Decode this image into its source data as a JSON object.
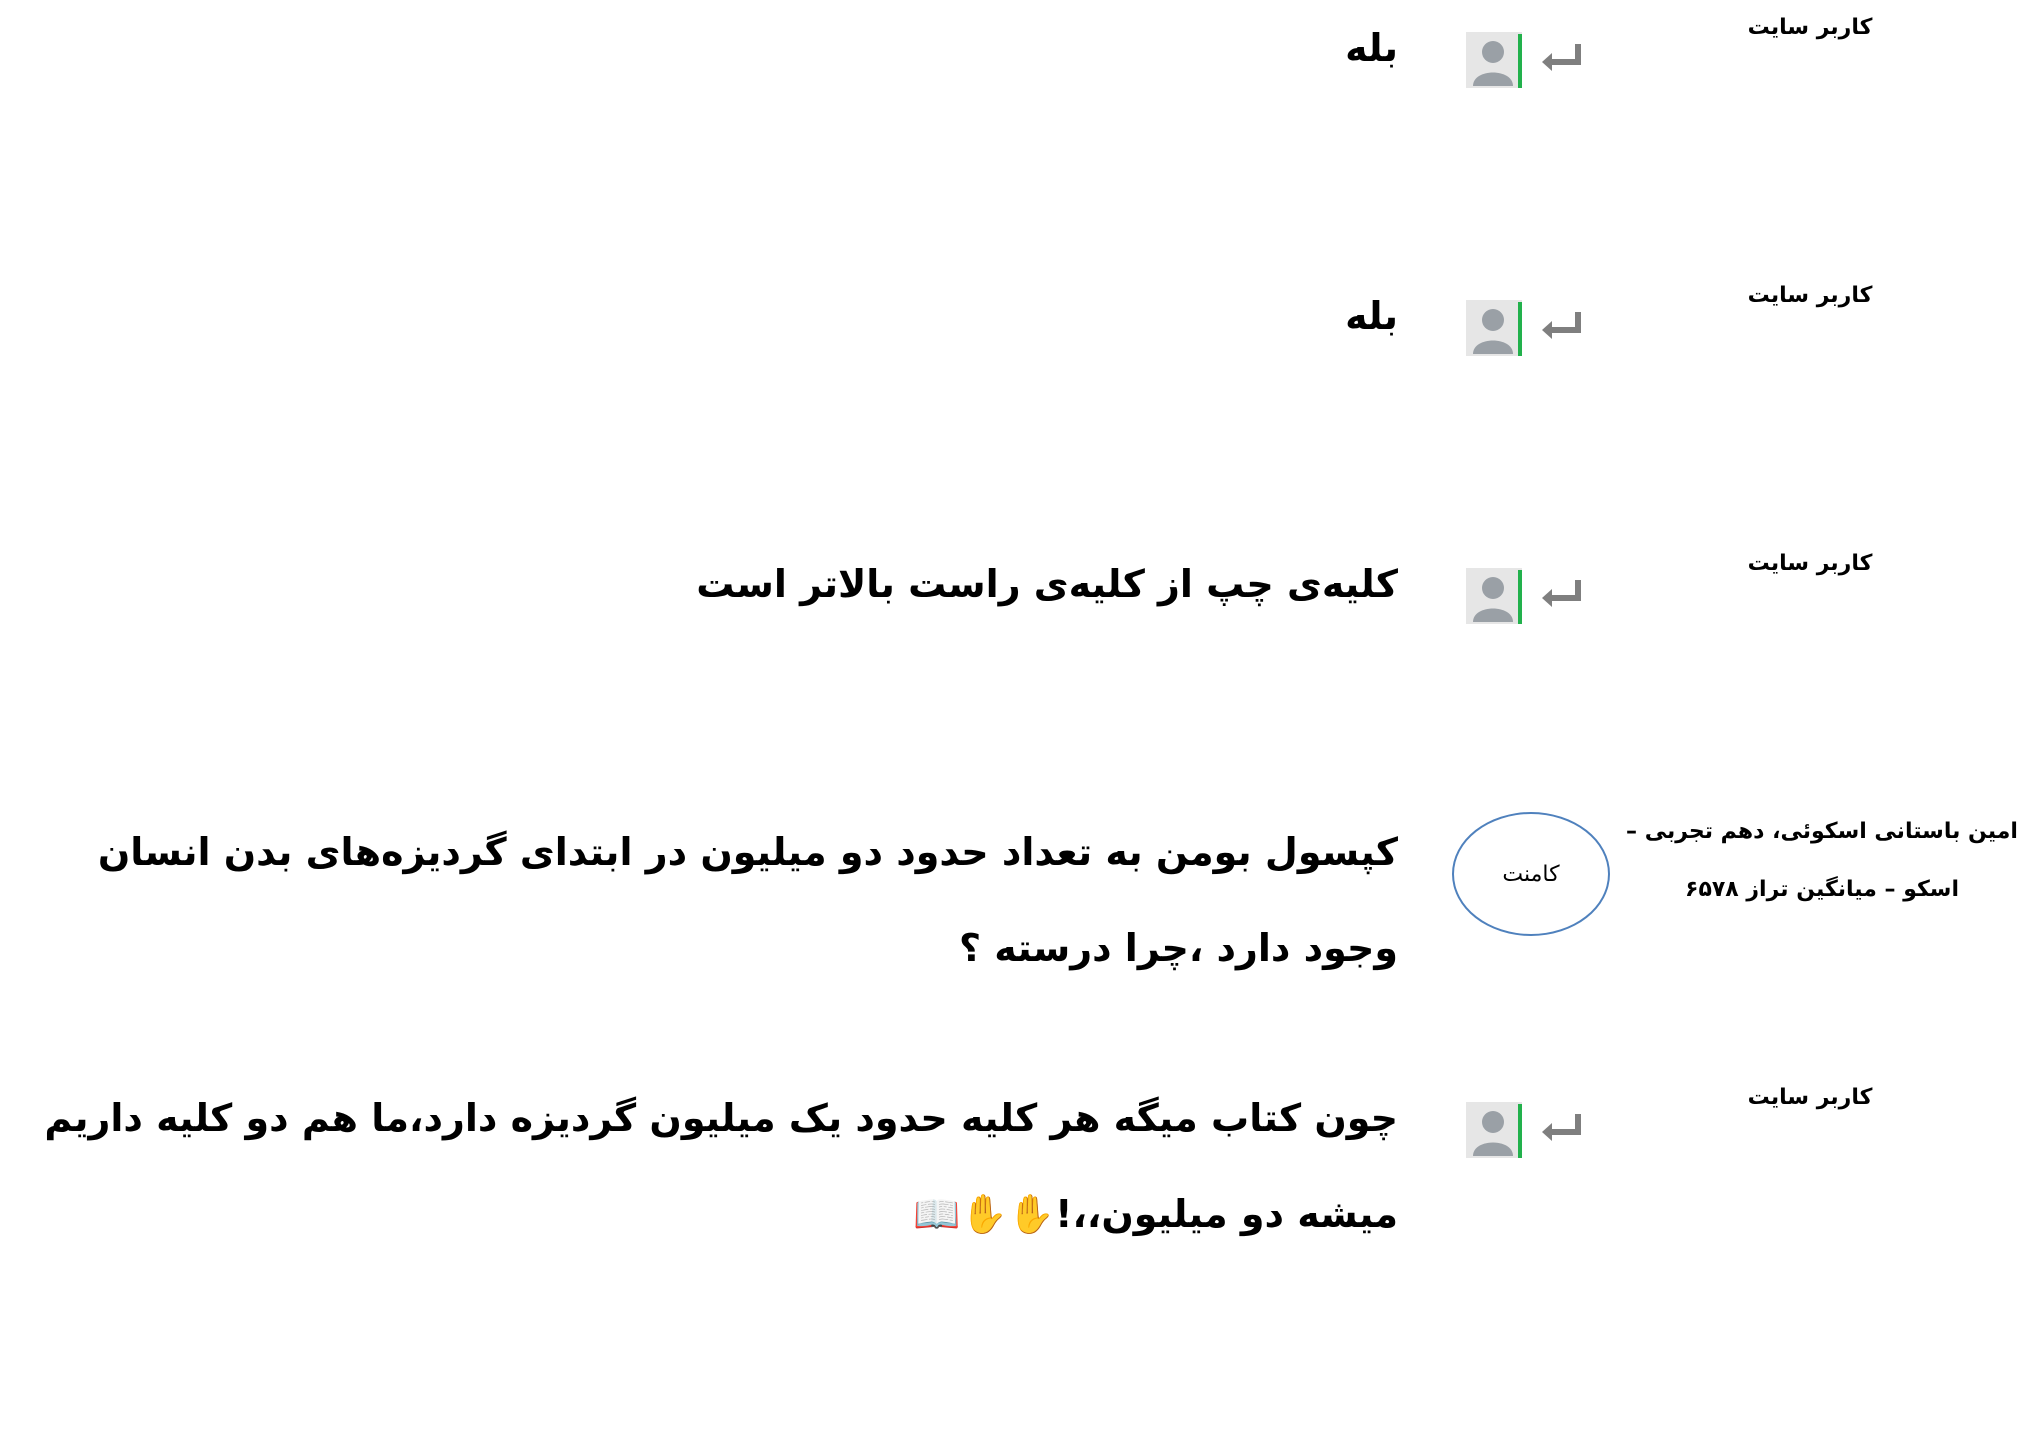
{
  "thread": {
    "entries": [
      {
        "author": "کاربر سایت",
        "author_line2": "",
        "badge": "",
        "icons": [
          "reply-arrow-icon",
          "user-avatar-icon"
        ],
        "text": "بله"
      },
      {
        "author": "کاربر سایت",
        "author_line2": "",
        "badge": "",
        "icons": [
          "reply-arrow-icon",
          "user-avatar-icon"
        ],
        "text": "بله"
      },
      {
        "author": "کاربر سایت",
        "author_line2": "",
        "badge": "",
        "icons": [
          "reply-arrow-icon",
          "user-avatar-icon"
        ],
        "text": "کلیه‌ی چپ از کلیه‌ی راست بالاتر است"
      },
      {
        "author": "امین باستانی اسکوئی، دهم تجربی –",
        "author_line2": "اسکو – میانگین تراز ۶۵۷۸",
        "badge": "کامنت",
        "icons": [],
        "text": "کپسول بومن به تعداد حدود دو میلیون در ابتدای گردیزه‌های بدن انسان وجود دارد ،چرا درسته ؟"
      },
      {
        "author": "کاربر سایت",
        "author_line2": "",
        "badge": "",
        "icons": [
          "reply-arrow-icon",
          "user-avatar-icon"
        ],
        "text": "چون کتاب میگه هر کلیه حدود یک میلیون گردیزه دارد،ما هم دو کلیه داریم میشه دو میلیون،،!✋✋📖"
      }
    ]
  },
  "colors": {
    "avatar_frame": "#22b14c",
    "avatar_bg": "#e6e6e6",
    "avatar_figure": "#9aa0a6",
    "reply_arrow": "#7f7f7f",
    "badge_border": "#4f81bd"
  }
}
